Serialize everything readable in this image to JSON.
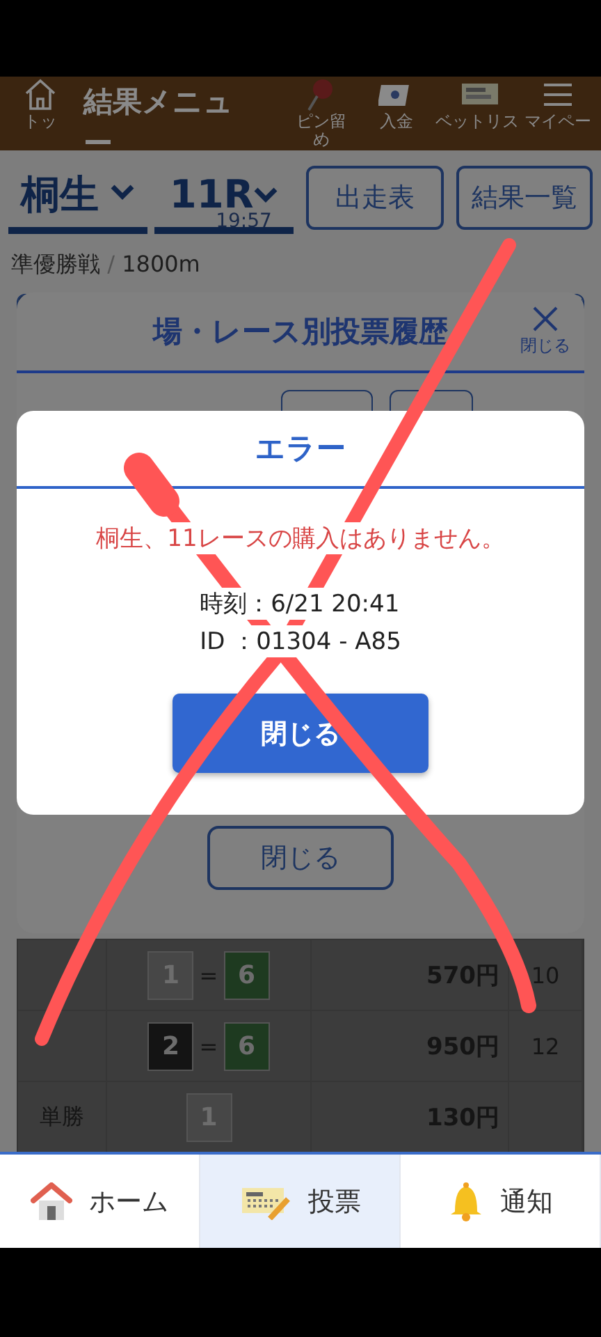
{
  "header": {
    "home_label": "トッ",
    "title_lines": [
      "結果メニュ",
      "ー"
    ],
    "items": [
      {
        "kind": "pin",
        "label_lines": [
          "ピン留",
          "め"
        ]
      },
      {
        "kind": "deposit",
        "label_lines": [
          "入金"
        ]
      },
      {
        "kind": "betlist",
        "label_lines": [
          "ベットリス"
        ]
      },
      {
        "kind": "menu",
        "label_lines": [
          "マイペー"
        ]
      }
    ]
  },
  "race_bar": {
    "venue": "桐生",
    "race": "11R",
    "time": "19:57",
    "buttons": [
      "出走表",
      "結果一覧"
    ]
  },
  "race_info": {
    "name": "準優勝戦",
    "separator": "/",
    "distance": "1800m"
  },
  "history_modal": {
    "title": "場・レース別投票履歴",
    "close_label": "閉じる",
    "close_button": "閉じる"
  },
  "error_dialog": {
    "title": "エラー",
    "message": "桐生、11レースの購入はありません。",
    "lines": [
      "時刻：6/21 20:41",
      "ID ：01304 - A85"
    ],
    "button": "閉じる"
  },
  "results": [
    {
      "numbers": [
        {
          "text": "1",
          "color": "#474747"
        },
        {
          "text": "6",
          "color": "#1e3a20"
        }
      ],
      "joiner": "=",
      "payout": "570円",
      "popularity": "10"
    },
    {
      "numbers": [
        {
          "text": "2",
          "color": "#141414"
        },
        {
          "text": "6",
          "color": "#1e3a20"
        }
      ],
      "joiner": "=",
      "payout": "950円",
      "popularity": "12"
    },
    {
      "bet_type": "単勝",
      "numbers": [
        {
          "text": "1",
          "color": "#474747"
        }
      ],
      "payout": "130円"
    }
  ],
  "bottom_nav": [
    {
      "kind": "home",
      "label": "ホーム",
      "selected": false
    },
    {
      "kind": "vote",
      "label": "投票",
      "selected": true
    },
    {
      "kind": "notice",
      "label": "通知",
      "selected": false
    }
  ]
}
